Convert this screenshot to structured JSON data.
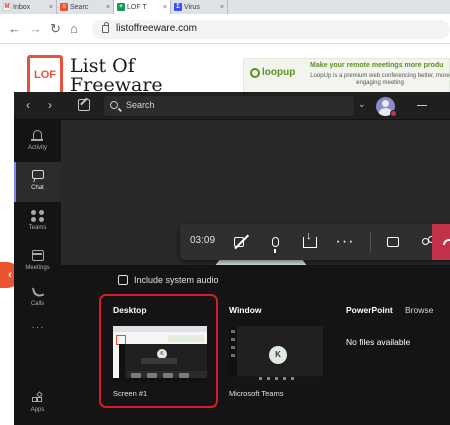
{
  "browser": {
    "tabs": [
      {
        "title": "Inbox",
        "favicon": "gmail-icon",
        "color": "#ffffff",
        "glyph": "M",
        "glyph_color": "#d93025"
      },
      {
        "title": "Searc",
        "favicon": "search-doc-icon",
        "color": "#e8552f",
        "glyph": "≡",
        "glyph_color": "#ffffff"
      },
      {
        "title": "LOF T",
        "favicon": "sheets-icon",
        "color": "#0f9d58",
        "glyph": "+",
        "glyph_color": "#ffffff"
      },
      {
        "title": "Virus",
        "favicon": "virustotal-icon",
        "color": "#394eff",
        "glyph": "Σ",
        "glyph_color": "#ffffff"
      }
    ],
    "url": "listoffreeware.com"
  },
  "website": {
    "logo_text": "LOF",
    "name_line1": "List Of",
    "name_line2": "Freeware",
    "ad": {
      "brand": "loopup",
      "headline": "Make your remote meetings more produ",
      "text": "LoopUp is a premium web conferencing better, more engaging meeting"
    }
  },
  "teams": {
    "search_placeholder": "Search",
    "rail": [
      {
        "label": "Activity",
        "icon": "bell-icon"
      },
      {
        "label": "Chat",
        "icon": "chat-icon",
        "active": true
      },
      {
        "label": "Teams",
        "icon": "teams-icon"
      },
      {
        "label": "Meetings",
        "icon": "calendar-icon"
      },
      {
        "label": "Calls",
        "icon": "phone-icon"
      },
      {
        "label": "",
        "icon": "more-icon"
      },
      {
        "label": "Apps",
        "icon": "apps-icon"
      }
    ],
    "call": {
      "timer": "03:09",
      "controls": [
        "camera-off-icon",
        "microphone-icon",
        "share-tray-icon",
        "more-options-icon",
        "chat-icon",
        "participants-icon",
        "hang-up-icon"
      ],
      "end_color": "#c4314b"
    },
    "share_tray": {
      "include_audio_label": "Include system audio",
      "desktop_title": "Desktop",
      "desktop_caption": "Screen #1",
      "window_title": "Window",
      "window_caption": "Microsoft Teams",
      "window_avatar": "K",
      "powerpoint_title": "PowerPoint",
      "browse_label": "Browse",
      "no_files": "No files available",
      "highlight_color": "#d91b2a"
    }
  }
}
